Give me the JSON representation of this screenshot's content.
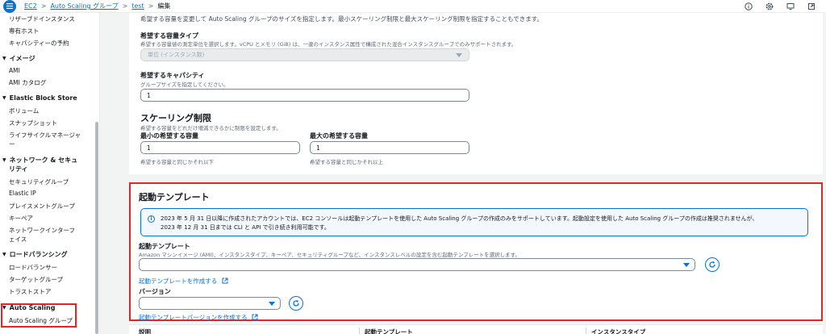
{
  "breadcrumb": {
    "items": [
      "EC2",
      "Auto Scaling グループ",
      "test"
    ],
    "current": "編集"
  },
  "sidebar": {
    "items": [
      {
        "type": "item",
        "label": "リザーブドインスタンス"
      },
      {
        "type": "item",
        "label": "専有ホスト"
      },
      {
        "type": "item",
        "label": "キャパシティーの予約"
      },
      {
        "type": "head",
        "label": "イメージ"
      },
      {
        "type": "item",
        "label": "AMI"
      },
      {
        "type": "item",
        "label": "AMI カタログ"
      },
      {
        "type": "head",
        "label": "Elastic Block Store"
      },
      {
        "type": "item",
        "label": "ボリューム"
      },
      {
        "type": "item",
        "label": "スナップショット"
      },
      {
        "type": "item",
        "label": "ライフサイクルマネージャ"
      },
      {
        "type": "item",
        "label": "ー"
      },
      {
        "type": "head",
        "label": "ネットワーク & セキュ"
      },
      {
        "type": "head2",
        "label": "リティ"
      },
      {
        "type": "item",
        "label": "セキュリティグループ"
      },
      {
        "type": "item",
        "label": "Elastic IP"
      },
      {
        "type": "item",
        "label": "プレイスメントグループ"
      },
      {
        "type": "item",
        "label": "キーペア"
      },
      {
        "type": "item",
        "label": "ネットワークインターフ"
      },
      {
        "type": "item",
        "label": "ェイス"
      },
      {
        "type": "head",
        "label": "ロードバランシング"
      },
      {
        "type": "item",
        "label": "ロードバランサー"
      },
      {
        "type": "item",
        "label": "ターゲットグループ"
      },
      {
        "type": "item",
        "label": "トラストストア"
      },
      {
        "type": "head",
        "label": "Auto Scaling"
      },
      {
        "type": "item",
        "label": "Auto Scaling グループ"
      }
    ]
  },
  "capacity": {
    "intro": "希望する容量を変更して Auto Scaling グループのサイズを指定します。最小スケーリング制限と最大スケーリング制限を指定することもできます。",
    "type_label": "希望する容量タイプ",
    "type_desc": "希望する容量値の測定単位を選択します。vCPU とメモリ (GiB) は、一連のインスタンス属性で構成された混合インスタンスグループでのみサポートされます。",
    "type_value": "単位 (インスタンス数)",
    "desired_label": "希望するキャパシティ",
    "desired_desc": "グループサイズを指定してください。",
    "desired_value": "1",
    "scaling_title": "スケーリング制限",
    "scaling_desc": "希望する容量をどれだけ増減できるかに制限を設定します。",
    "min_label": "最小の希望する容量",
    "min_value": "1",
    "min_hint": "希望する容量と同じかそれ以下",
    "max_label": "最大の希望する容量",
    "max_value": "1",
    "max_hint": "希望する容量と同じかそれ以上"
  },
  "launch_template": {
    "title": "起動テンプレート",
    "info_line1": "2023 年 5 月 31 日以降に作成されたアカウントでは、EC2 コンソールは起動テンプレートを使用した Auto Scaling グループの作成のみをサポートしています。起動設定を使用した Auto Scaling グループの作成は推奨されませんが、",
    "info_line2": "2023 年 12 月 31 日までは CLI と API で引き続き利用可能です。",
    "field_label": "起動テンプレート",
    "field_desc": "Amazon マシンイメージ (AMI)、インスタンスタイプ、キーペア、セキュリティグループなど、インスタンスレベルの設定を含む起動テンプレートを選択します。",
    "create_link": "起動テンプレートを作成する",
    "version_label": "バージョン",
    "create_version_link": "起動テンプレートバージョンを作成する"
  },
  "table": {
    "headers": [
      "説明",
      "起動テンプレート",
      "インスタンスタイプ"
    ]
  }
}
